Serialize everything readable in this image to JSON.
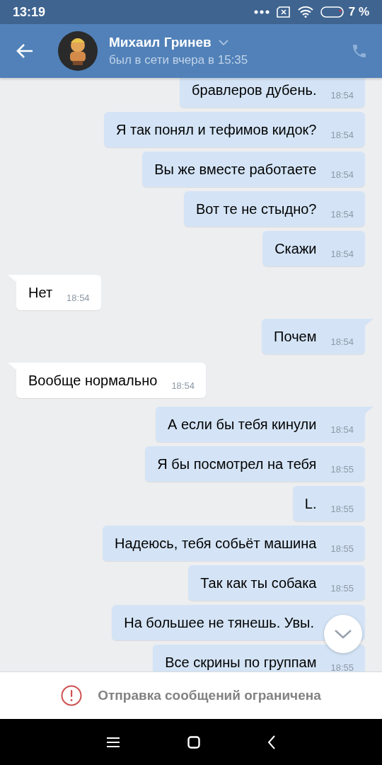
{
  "status_bar": {
    "time": "13:19",
    "battery": "7 %"
  },
  "header": {
    "name": "Михаил Гринев",
    "status": "был в сети вчера в 15:35"
  },
  "messages": [
    {
      "kind": "out",
      "text": "бравлеров дубень.",
      "time": "18:54"
    },
    {
      "kind": "out",
      "tail": false,
      "text": "Я так понял и тефимов кидок?",
      "time": "18:54"
    },
    {
      "kind": "out",
      "tail": false,
      "text": "Вы же вместе работаете",
      "time": "18:54"
    },
    {
      "kind": "out",
      "tail": false,
      "text": "Вот те не стыдно?",
      "time": "18:54"
    },
    {
      "kind": "out",
      "tail": false,
      "text": "Скажи",
      "time": "18:54"
    },
    {
      "kind": "in",
      "tail": true,
      "text": "Нет",
      "time": "18:54"
    },
    {
      "kind": "out",
      "tail": true,
      "text": "Почем",
      "time": "18:54"
    },
    {
      "kind": "in",
      "tail": true,
      "text": "Вообще нормально",
      "time": "18:54"
    },
    {
      "kind": "out",
      "tail": true,
      "text": "А если бы тебя кинули",
      "time": "18:54"
    },
    {
      "kind": "out",
      "tail": false,
      "text": "Я бы посмотрел на тебя",
      "time": "18:55"
    },
    {
      "kind": "out",
      "tail": false,
      "text": "L.",
      "time": "18:55"
    },
    {
      "kind": "out",
      "tail": false,
      "text": "Надеюсь, тебя собьёт машина",
      "time": "18:55"
    },
    {
      "kind": "out",
      "tail": false,
      "text": "Так как ты собака",
      "time": "18:55"
    },
    {
      "kind": "out",
      "tail": false,
      "text": "На большее не тянешь. Увы."
    },
    {
      "kind": "out",
      "tail": false,
      "text": "Все скрины по группам",
      "time": "18:55"
    }
  ],
  "notice": "Отправка сообщений ограничена"
}
